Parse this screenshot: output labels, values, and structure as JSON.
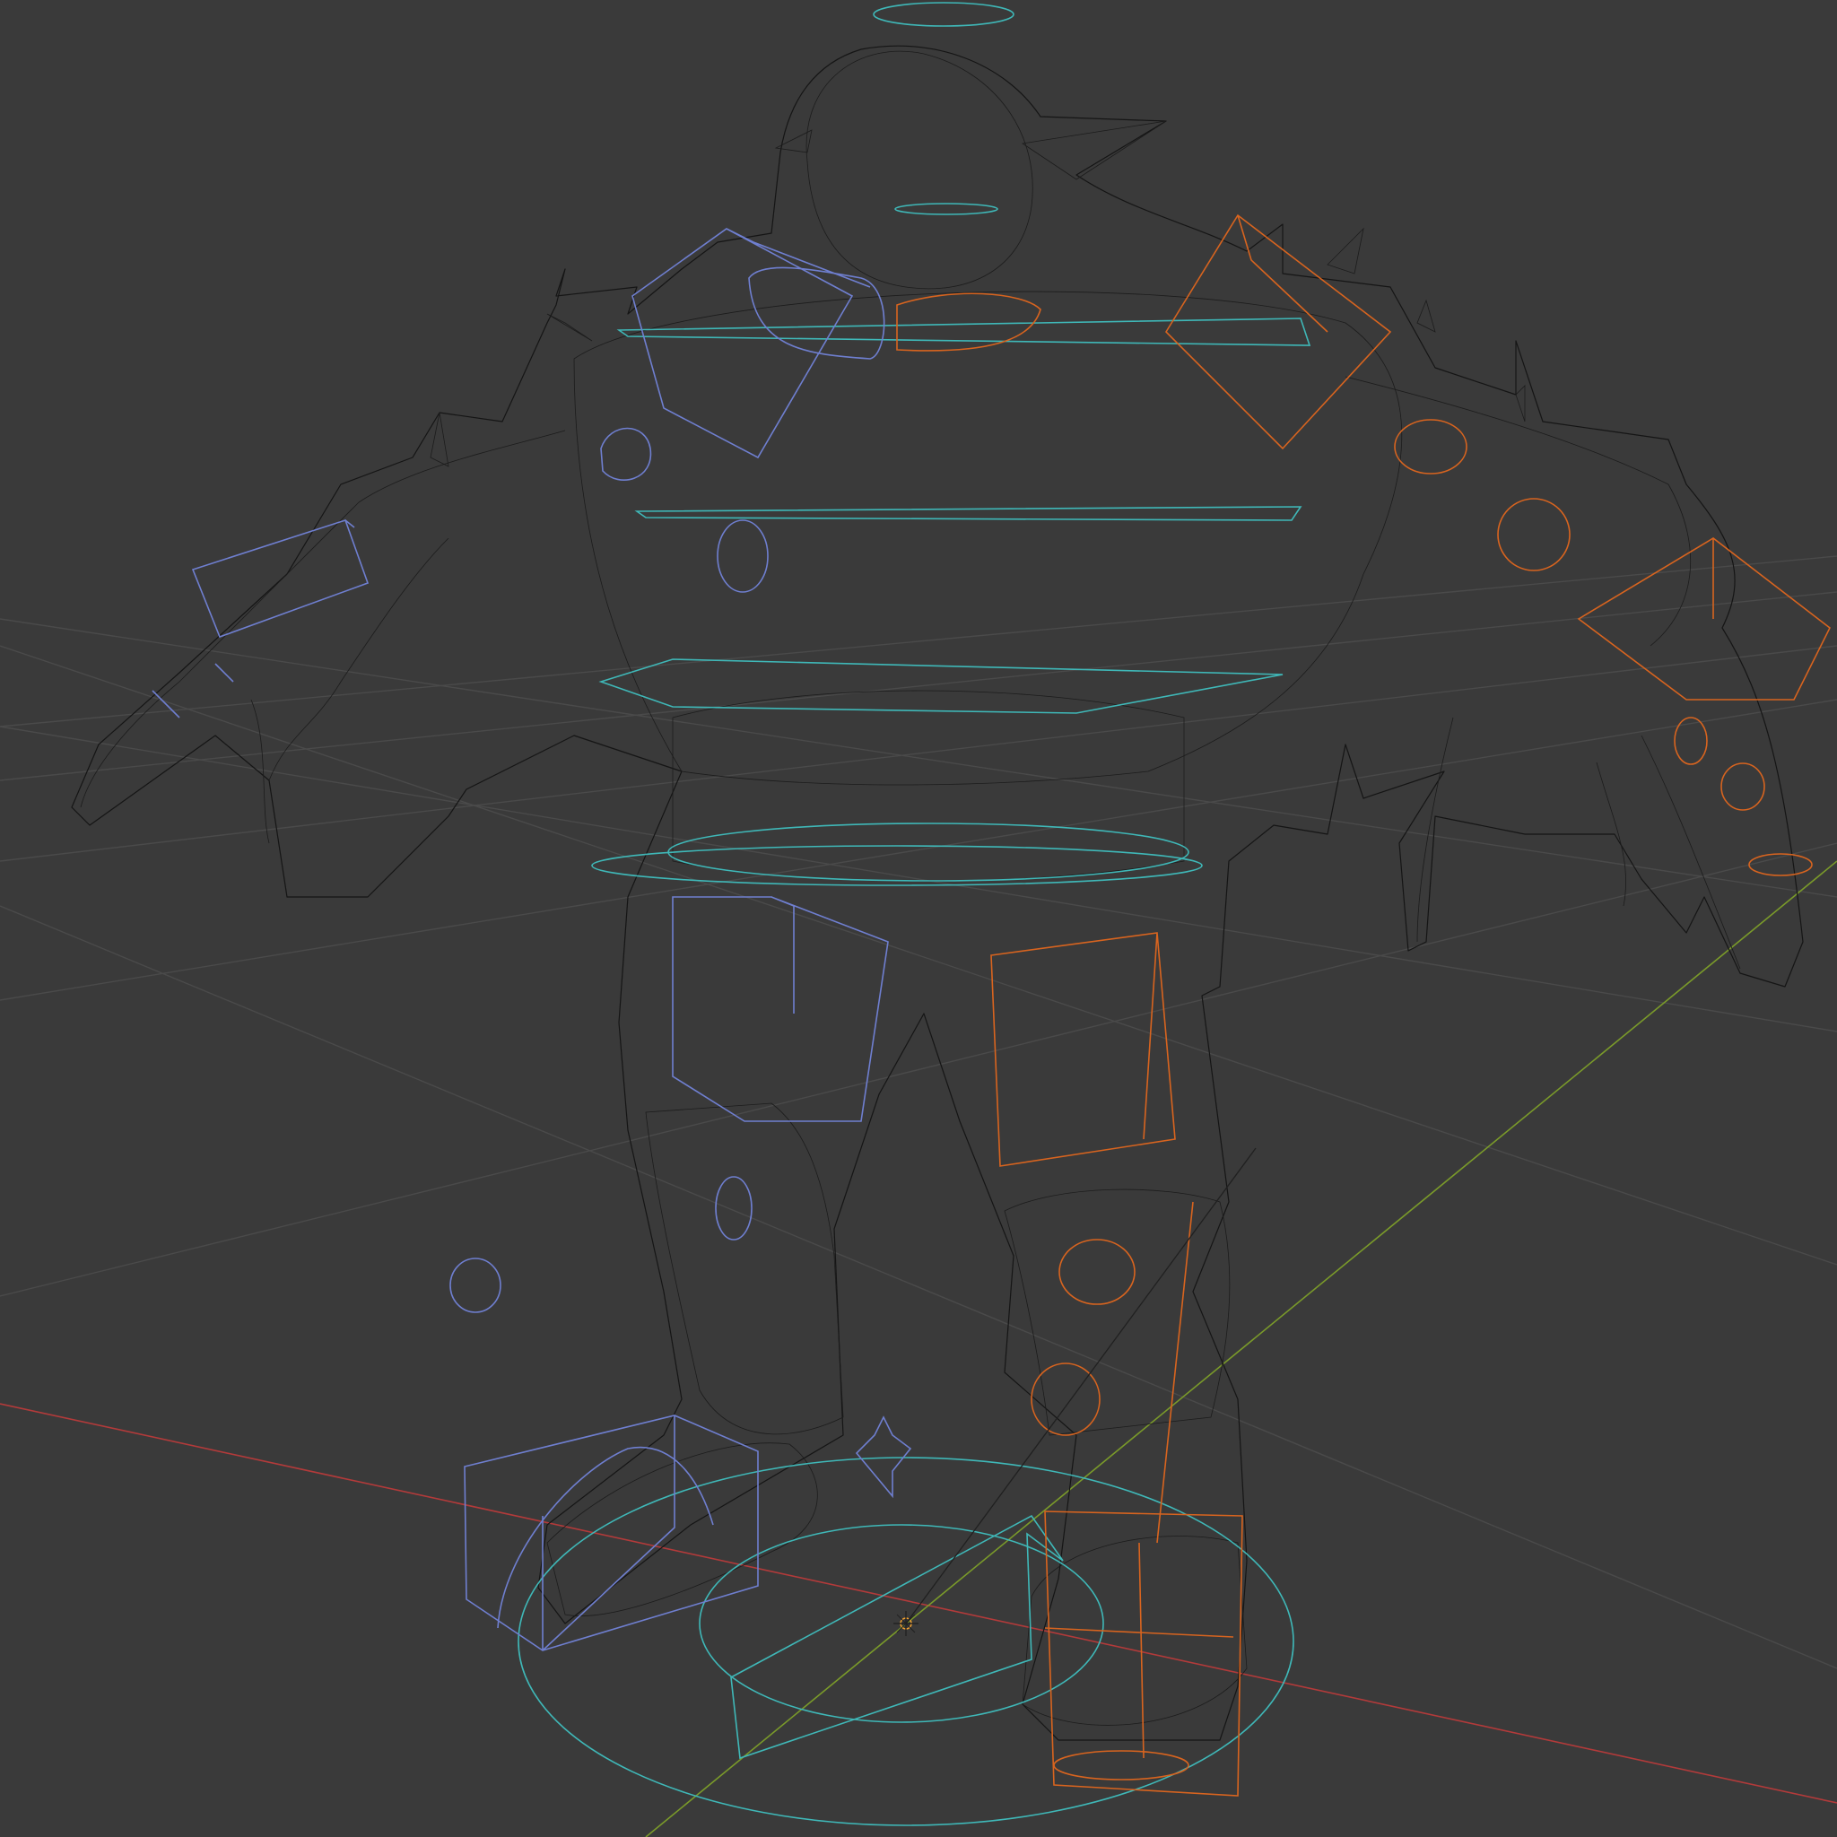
{
  "viewport": {
    "background": "#3a3a3a",
    "mode": "wireframe",
    "subject": "rigged-character-mesh"
  },
  "colors": {
    "grid": "#4a4a4a",
    "x_axis": "#b33a3a",
    "y_axis": "#7a9a2a",
    "mesh_wire": "#151515",
    "control_cyan": "#3fb8b8",
    "control_blue": "#6f7fd0",
    "control_orange": "#d8641f",
    "origin": "#f0a030"
  },
  "controls": {
    "cyan": [
      "head-ring",
      "neck-ring",
      "shoulder-ring",
      "chest-ring",
      "waist-ring",
      "hip-ring",
      "root-circle-inner",
      "root-circle-outer"
    ],
    "blue": [
      "left-shoulder-cube",
      "left-hand-cube",
      "left-leg-cube",
      "left-foot-cube",
      "left-knee-pole",
      "left-elbow-ring"
    ],
    "orange": [
      "right-shoulder-cube",
      "right-hand-cube",
      "right-leg-cube",
      "right-foot-cube",
      "right-knee-pole",
      "right-elbow-ring"
    ]
  }
}
